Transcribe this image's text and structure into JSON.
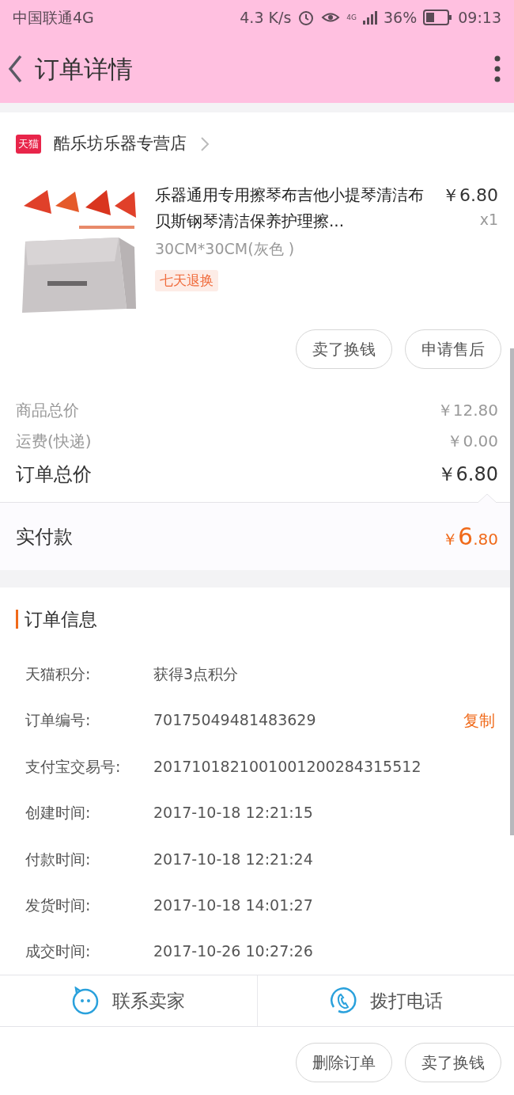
{
  "status_bar": {
    "carrier": "中国联通4G",
    "speed": "4.3 K/s",
    "network": "4G",
    "battery": "36%",
    "time": "09:13"
  },
  "header": {
    "title": "订单详情"
  },
  "store": {
    "badge": "天猫",
    "name": "酷乐坊乐器专营店"
  },
  "product": {
    "title": "乐器通用专用擦琴布吉他小提琴清洁布贝斯钢琴清洁保养护理擦...",
    "price": "￥6.80",
    "quantity": "x1",
    "sku": "30CM*30CM(灰色 )",
    "tag": "七天退换"
  },
  "item_buttons": [
    "卖了换钱",
    "申请售后"
  ],
  "summary": [
    {
      "kind": "minor",
      "label": "商品总价",
      "value": "￥12.80"
    },
    {
      "kind": "minor",
      "label": "运费(快递)",
      "value": "￥0.00"
    },
    {
      "kind": "major",
      "label": "订单总价",
      "value": "￥6.80"
    }
  ],
  "paid": {
    "label": "实付款",
    "currency": "￥",
    "integer": "6",
    "decimal": ".80"
  },
  "order_info": {
    "title": "订单信息",
    "rows": [
      {
        "label": "天猫积分:",
        "value": "获得3点积分"
      },
      {
        "label": "订单编号:",
        "value": "70175049481483629",
        "action": "复制"
      },
      {
        "label": "支付宝交易号:",
        "value": "2017101821001001200284315512"
      },
      {
        "label": "创建时间:",
        "value": "2017-10-18 12:21:15"
      },
      {
        "label": "付款时间:",
        "value": "2017-10-18 12:21:24"
      },
      {
        "label": "发货时间:",
        "value": "2017-10-18 14:01:27"
      },
      {
        "label": "成交时间:",
        "value": "2017-10-26 10:27:26"
      }
    ]
  },
  "contact": [
    {
      "kind": "chat",
      "label": "联系卖家"
    },
    {
      "kind": "phone",
      "label": "拨打电话"
    }
  ],
  "footer_buttons": [
    "删除订单",
    "卖了换钱"
  ]
}
